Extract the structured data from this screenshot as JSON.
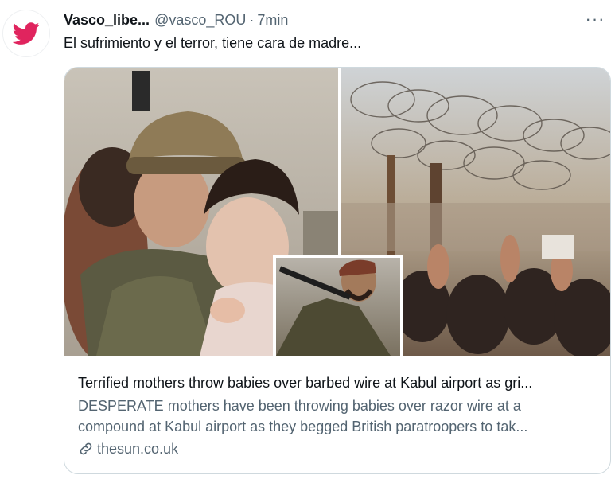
{
  "tweet": {
    "display_name": "Vasco_libe...",
    "handle": "@vasco_ROU",
    "separator": "·",
    "time": "7min",
    "text": "El sufrimiento y el terror, tiene cara de madre...",
    "more_label": "···",
    "avatar_icon": "twitter-bird-icon",
    "brand_color": "#e0245e"
  },
  "card": {
    "title": "Terrified mothers throw babies over barbed wire at Kabul airport as gri...",
    "description_lines": [
      "DESPERATE mothers have been throwing babies over razor wire at a",
      "compound at Kabul airport as they begged British paratroopers to tak..."
    ],
    "domain": "thesun.co.uk",
    "domain_icon": "link-icon"
  }
}
